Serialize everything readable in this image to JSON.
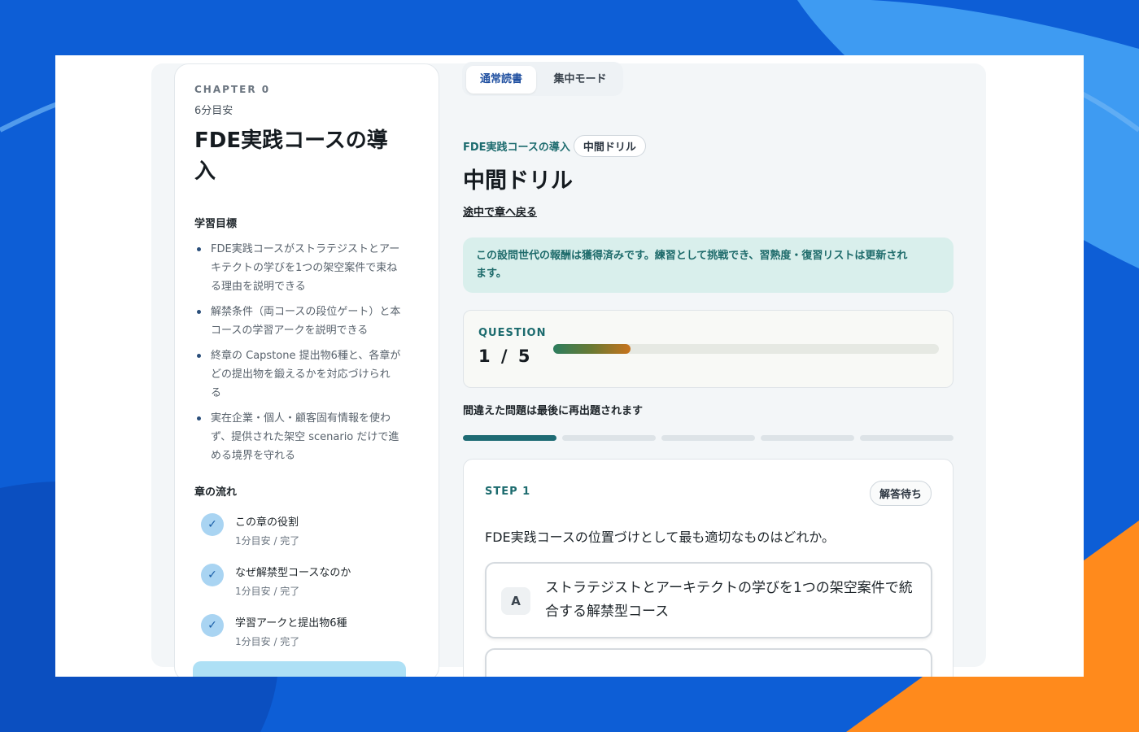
{
  "chapter": {
    "label": "CHAPTER 0",
    "time": "6分目安",
    "title_line1": "FDE実践コースの導",
    "title_line2": "入",
    "goals_heading": "学習目標",
    "goals": [
      {
        "l1": "FDE実践コースがストラテジストとアー",
        "l2": "キテクトの学びを1つの架空案件で束ね",
        "l3": "る理由を説明できる"
      },
      {
        "l1": "解禁条件（両コースの段位ゲート）と本",
        "l2": "コースの学習アークを説明できる",
        "l3": ""
      },
      {
        "l1": "終章の Capstone 提出物6種と、各章が",
        "l2": "どの提出物を鍛えるかを対応づけられ",
        "l3": "る"
      },
      {
        "l1": "実在企業・個人・顧客固有情報を使わ",
        "l2": "ず、提供された架空 scenario だけで進",
        "l3": "める境界を守れる"
      }
    ],
    "flow_heading": "章の流れ",
    "flow": [
      {
        "title": "この章の役割",
        "sub": "1分目安 / 完了"
      },
      {
        "title": "なぜ解禁型コースなのか",
        "sub": "1分目安 / 完了"
      },
      {
        "title": "学習アークと提出物6種",
        "sub": "1分目安 / 完了"
      }
    ]
  },
  "tabs": {
    "normal": "通常読書",
    "focus": "集中モード"
  },
  "breadcrumb": {
    "course": "FDE実践コースの導入",
    "badge": "中間ドリル"
  },
  "drill": {
    "title": "中間ドリル",
    "back": "途中で章へ戻る",
    "notice_l1": "この設問世代の報酬は獲得済みです。練習として挑戦でき、習熟度・復習リストは更新され",
    "notice_l2": "ます。",
    "question_label": "QUESTION",
    "current": 1,
    "total": 5,
    "question_count": "1 / 5",
    "progress_fraction": 0.2,
    "retry_note": "間違えた問題は最後に再出題されます",
    "segments": [
      true,
      false,
      false,
      false,
      false
    ]
  },
  "step": {
    "label": "STEP 1",
    "status": "解答待ち",
    "question": "FDE実践コースの位置づけとして最も適切なものはどれか。",
    "options": [
      {
        "key": "A",
        "l1": "ストラテジストとアーキテクトの学びを1つの架空案件で統",
        "l2": "合する解禁型コース"
      }
    ]
  },
  "colors": {
    "accent": "#1c6b6e",
    "tab_active": "#1f4fa0",
    "check_bg": "#a9d4f2"
  }
}
